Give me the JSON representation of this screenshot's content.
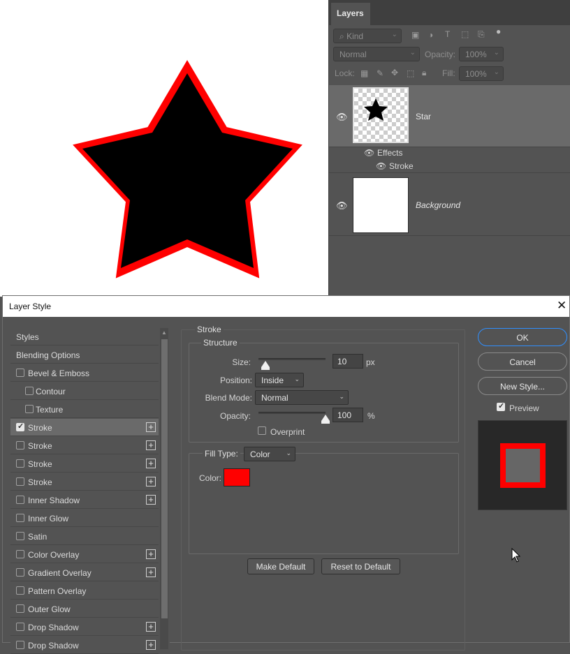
{
  "canvas": {
    "shape": "star",
    "fill_color": "#000000",
    "stroke_color": "#ff0000"
  },
  "layers_panel": {
    "tab_label": "Layers",
    "kind_filter": "Kind",
    "blend_mode": "Normal",
    "opacity_label": "Opacity:",
    "opacity_value": "100%",
    "lock_label": "Lock:",
    "fill_label": "Fill:",
    "fill_value": "100%",
    "layers": [
      {
        "name": "Star",
        "selected": true,
        "effects_label": "Effects",
        "effect": "Stroke"
      },
      {
        "name": "Background",
        "selected": false
      }
    ]
  },
  "dialog": {
    "title": "Layer Style",
    "style_list": [
      {
        "label": "Styles",
        "checkbox": false,
        "plus": false,
        "indent": false
      },
      {
        "label": "Blending Options",
        "checkbox": false,
        "plus": false,
        "indent": false
      },
      {
        "label": "Bevel & Emboss",
        "checkbox": true,
        "checked": false,
        "plus": false,
        "indent": false
      },
      {
        "label": "Contour",
        "checkbox": true,
        "checked": false,
        "plus": false,
        "indent": true
      },
      {
        "label": "Texture",
        "checkbox": true,
        "checked": false,
        "plus": false,
        "indent": true
      },
      {
        "label": "Stroke",
        "checkbox": true,
        "checked": true,
        "plus": true,
        "indent": false,
        "selected": true
      },
      {
        "label": "Stroke",
        "checkbox": true,
        "checked": false,
        "plus": true,
        "indent": false
      },
      {
        "label": "Stroke",
        "checkbox": true,
        "checked": false,
        "plus": true,
        "indent": false
      },
      {
        "label": "Stroke",
        "checkbox": true,
        "checked": false,
        "plus": true,
        "indent": false
      },
      {
        "label": "Inner Shadow",
        "checkbox": true,
        "checked": false,
        "plus": true,
        "indent": false
      },
      {
        "label": "Inner Glow",
        "checkbox": true,
        "checked": false,
        "plus": false,
        "indent": false
      },
      {
        "label": "Satin",
        "checkbox": true,
        "checked": false,
        "plus": false,
        "indent": false
      },
      {
        "label": "Color Overlay",
        "checkbox": true,
        "checked": false,
        "plus": true,
        "indent": false
      },
      {
        "label": "Gradient Overlay",
        "checkbox": true,
        "checked": false,
        "plus": true,
        "indent": false
      },
      {
        "label": "Pattern Overlay",
        "checkbox": true,
        "checked": false,
        "plus": false,
        "indent": false
      },
      {
        "label": "Outer Glow",
        "checkbox": true,
        "checked": false,
        "plus": false,
        "indent": false
      },
      {
        "label": "Drop Shadow",
        "checkbox": true,
        "checked": false,
        "plus": true,
        "indent": false
      },
      {
        "label": "Drop Shadow",
        "checkbox": true,
        "checked": false,
        "plus": true,
        "indent": false
      }
    ],
    "stroke": {
      "section_title": "Stroke",
      "structure_title": "Structure",
      "size_label": "Size:",
      "size_value": "10",
      "size_unit": "px",
      "size_slider": 0.1,
      "position_label": "Position:",
      "position_value": "Inside",
      "blend_label": "Blend Mode:",
      "blend_value": "Normal",
      "opacity_label": "Opacity:",
      "opacity_value": "100",
      "opacity_unit": "%",
      "opacity_slider": 1.0,
      "overprint_label": "Overprint",
      "fill_type_label": "Fill Type:",
      "fill_type_value": "Color",
      "color_label": "Color:",
      "color_value": "#ff0000"
    },
    "make_default": "Make Default",
    "reset_default": "Reset to Default",
    "ok": "OK",
    "cancel": "Cancel",
    "new_style": "New Style...",
    "preview_label": "Preview",
    "preview_checked": true
  }
}
